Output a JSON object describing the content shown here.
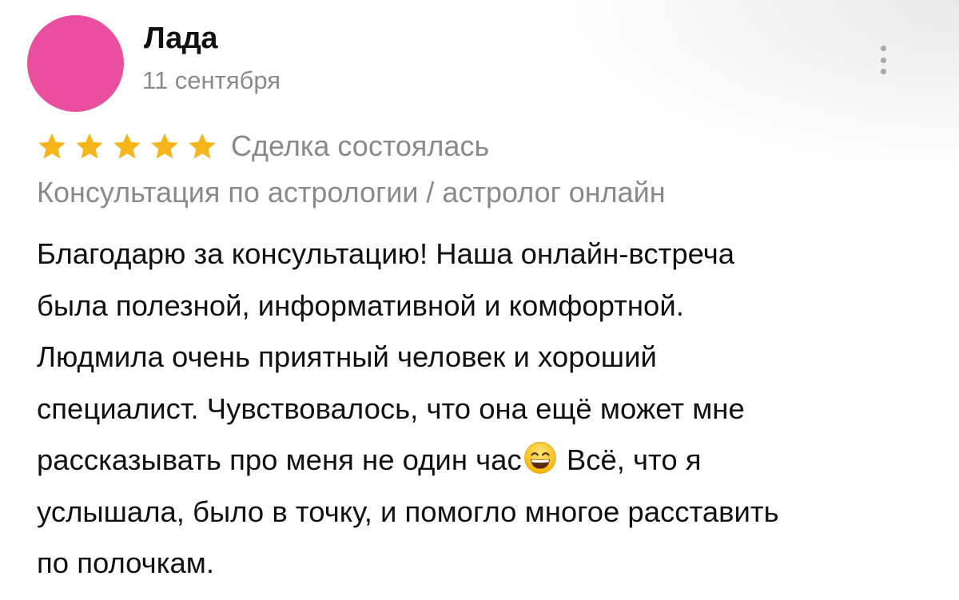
{
  "review": {
    "author_name": "Лада",
    "date": "11 сентября",
    "avatar_color": "#ea4f9f",
    "rating": 5,
    "rating_max": 5,
    "star_color": "#f6b51a",
    "deal_status": "Сделка состоялась",
    "service_title": "Консультация по астрологии / астролог онлайн",
    "text_lines": [
      "Благодарю за консультацию! Наша онлайн-встреча",
      "была полезной, информативной и комфортной.",
      "Людмила очень приятный человек и хороший",
      "специалист. Чувствовалось, что она ещё может мне",
      "рассказывать про меня не один час",
      "Всё, что я",
      "услышала, было в точку, и помогло многое расставить",
      "по полочкам."
    ],
    "emoji_icon": "grinning-face-with-smiling-eyes-icon",
    "menu_icon": "more-vertical-icon"
  }
}
